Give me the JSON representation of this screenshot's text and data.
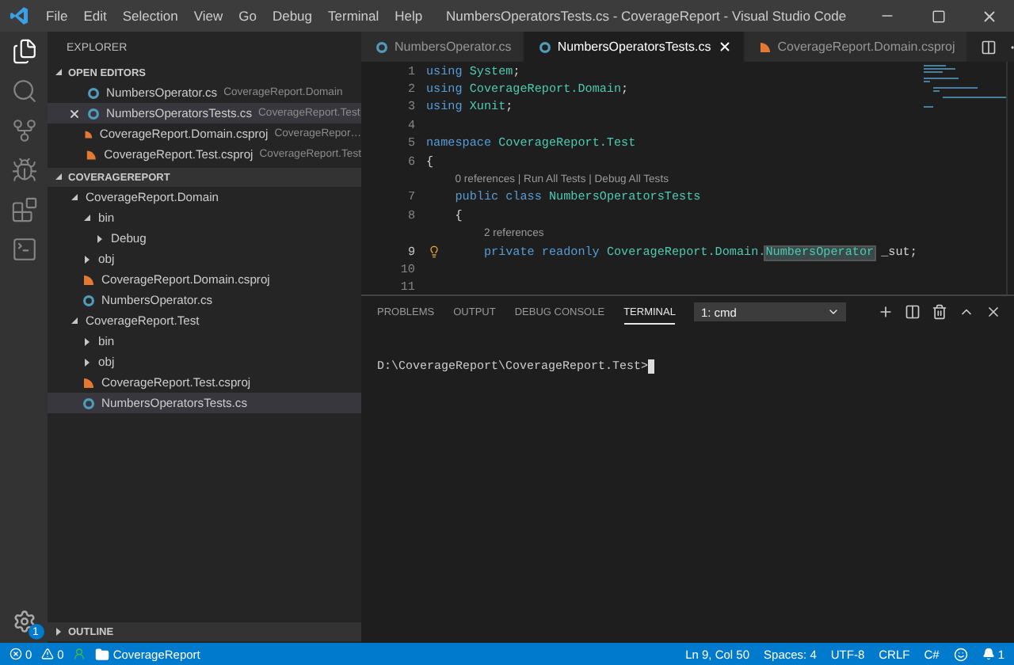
{
  "title_bar": {
    "menu": [
      "File",
      "Edit",
      "Selection",
      "View",
      "Go",
      "Debug",
      "Terminal",
      "Help"
    ],
    "title": "NumbersOperatorsTests.cs - CoverageReport - Visual Studio Code"
  },
  "activity_bar": {
    "items": [
      {
        "kind": "files",
        "selected": true
      },
      {
        "kind": "search",
        "selected": false
      },
      {
        "kind": "source-control",
        "selected": false
      },
      {
        "kind": "debug",
        "selected": false
      },
      {
        "kind": "extensions",
        "selected": false
      },
      {
        "kind": "terminal",
        "selected": false
      }
    ],
    "settings_badge": "1"
  },
  "sidebar": {
    "title": "EXPLORER",
    "open_editors": {
      "title": "OPEN EDITORS",
      "expanded": true,
      "items": [
        {
          "name": "NumbersOperator.cs",
          "description": "CoverageReport.Domain",
          "kind": "cs",
          "selected": false
        },
        {
          "name": "NumbersOperatorsTests.cs",
          "description": "CoverageReport.Test",
          "kind": "cs",
          "selected": true
        },
        {
          "name": "CoverageReport.Domain.csproj",
          "description": "CoverageRepor…",
          "kind": "csproj",
          "selected": false
        },
        {
          "name": "CoverageReport.Test.csproj",
          "description": "CoverageReport.Test",
          "kind": "csproj",
          "selected": false
        }
      ]
    },
    "folder": {
      "title": "COVERAGEREPORT",
      "expanded": true,
      "tree": [
        {
          "name": "CoverageReport.Domain",
          "kind": "folder",
          "expanded": true,
          "selected": false,
          "children": [
            {
              "name": "bin",
              "kind": "folder",
              "expanded": true,
              "selected": false,
              "children": [
                {
                  "name": "Debug",
                  "kind": "folder",
                  "expanded": false,
                  "selected": false
                }
              ]
            },
            {
              "name": "obj",
              "kind": "folder",
              "expanded": false,
              "selected": false
            },
            {
              "name": "CoverageReport.Domain.csproj",
              "kind": "csproj",
              "selected": false
            },
            {
              "name": "NumbersOperator.cs",
              "kind": "cs",
              "selected": false
            }
          ]
        },
        {
          "name": "CoverageReport.Test",
          "kind": "folder",
          "expanded": true,
          "selected": false,
          "children": [
            {
              "name": "bin",
              "kind": "folder",
              "expanded": false,
              "selected": false
            },
            {
              "name": "obj",
              "kind": "folder",
              "expanded": false,
              "selected": false
            },
            {
              "name": "CoverageReport.Test.csproj",
              "kind": "csproj",
              "selected": false
            },
            {
              "name": "NumbersOperatorsTests.cs",
              "kind": "cs",
              "selected": true
            }
          ]
        }
      ]
    },
    "outline": {
      "title": "OUTLINE",
      "expanded": false
    }
  },
  "editor": {
    "tabs": [
      {
        "label": "NumbersOperator.cs",
        "kind": "cs",
        "selected": false
      },
      {
        "label": "NumbersOperatorsTests.cs",
        "kind": "cs",
        "selected": true
      },
      {
        "label": "CoverageReport.Domain.csproj",
        "kind": "csproj",
        "selected": false
      }
    ],
    "lines": [
      {
        "kind": "code",
        "number": "1",
        "current": false,
        "tokens": [
          {
            "text": "using ",
            "kind": "keyword"
          },
          {
            "text": "System",
            "kind": "type"
          },
          {
            "text": ";",
            "kind": "plain"
          }
        ]
      },
      {
        "kind": "code",
        "number": "2",
        "current": false,
        "tokens": [
          {
            "text": "using ",
            "kind": "keyword"
          },
          {
            "text": "CoverageReport.Domain",
            "kind": "type"
          },
          {
            "text": ";",
            "kind": "plain"
          }
        ]
      },
      {
        "kind": "code",
        "number": "3",
        "current": false,
        "tokens": [
          {
            "text": "using ",
            "kind": "keyword"
          },
          {
            "text": "Xunit",
            "kind": "type"
          },
          {
            "text": ";",
            "kind": "plain"
          }
        ]
      },
      {
        "kind": "code",
        "number": "4",
        "current": false
      },
      {
        "kind": "code",
        "number": "5",
        "current": false,
        "tokens": [
          {
            "text": "namespace ",
            "kind": "keyword"
          },
          {
            "text": "CoverageReport.Test",
            "kind": "type"
          }
        ]
      },
      {
        "kind": "code",
        "number": "6",
        "current": false,
        "tokens": [
          {
            "text": "{",
            "kind": "plain"
          }
        ]
      },
      {
        "kind": "codelens",
        "text": "    0 references | Run All Tests | Debug All Tests"
      },
      {
        "kind": "code",
        "number": "7",
        "current": false,
        "tokens": [
          {
            "text": "    public class ",
            "kind": "keyword"
          },
          {
            "text": "NumbersOperatorsTests",
            "kind": "type"
          }
        ]
      },
      {
        "kind": "code",
        "number": "8",
        "current": false,
        "tokens": [
          {
            "text": "    {",
            "kind": "plain"
          }
        ]
      },
      {
        "kind": "codelens",
        "text": "        2 references"
      },
      {
        "kind": "code",
        "number": "9",
        "current": true,
        "tokens": [
          {
            "text": "        private readonly ",
            "kind": "keyword"
          },
          {
            "text": "CoverageReport.Domain.",
            "kind": "type"
          },
          {
            "text": "NumbersOperator",
            "kind": "highlight"
          },
          {
            "text": " _sut;",
            "kind": "plain"
          }
        ]
      },
      {
        "kind": "code",
        "number": "10",
        "current": false
      },
      {
        "kind": "code",
        "number": "11",
        "current": false
      }
    ]
  },
  "panel": {
    "tabs": [
      {
        "label": "PROBLEMS",
        "selected": false
      },
      {
        "label": "OUTPUT",
        "selected": false
      },
      {
        "label": "DEBUG CONSOLE",
        "selected": false
      },
      {
        "label": "TERMINAL",
        "selected": true
      }
    ],
    "terminal_select": "1: cmd",
    "terminal_text": "D:\\CoverageReport\\CoverageReport.Test>"
  },
  "status_bar": {
    "errors": "0",
    "warnings": "0",
    "folder": "CoverageReport",
    "items": [
      "Ln 9, Col 50",
      "Spaces: 4",
      "UTF-8",
      "CRLF",
      "C#"
    ],
    "notifications": "1"
  }
}
